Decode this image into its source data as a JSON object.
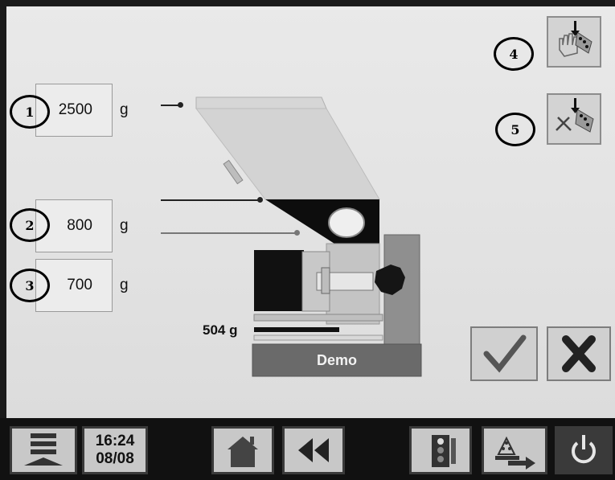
{
  "fields": [
    {
      "marker": "1",
      "value": "2500",
      "unit": "g"
    },
    {
      "marker": "2",
      "value": "800",
      "unit": "g"
    },
    {
      "marker": "3",
      "value": "700",
      "unit": "g"
    }
  ],
  "toolbar_markers": {
    "manual_fill": "4",
    "auto_fill": "5"
  },
  "machine": {
    "weight_reading": "504 g",
    "mode_label": "Demo"
  },
  "icons": {
    "manual_fill": "hand-fill-icon",
    "auto_fill": "tools-fill-icon",
    "confirm": "checkmark-icon",
    "cancel": "x-icon",
    "menu": "menu-icon",
    "home": "home-icon",
    "back": "rewind-icon",
    "info": "info-traffic-icon",
    "transfer": "transfer-icon",
    "power": "power-icon"
  },
  "status": {
    "time": "16:24",
    "date": "08/08"
  },
  "colors": {
    "hopper": "#d6d6d6",
    "base_bar": "#6a6a6a",
    "power_bg": "#3a3a3a"
  }
}
